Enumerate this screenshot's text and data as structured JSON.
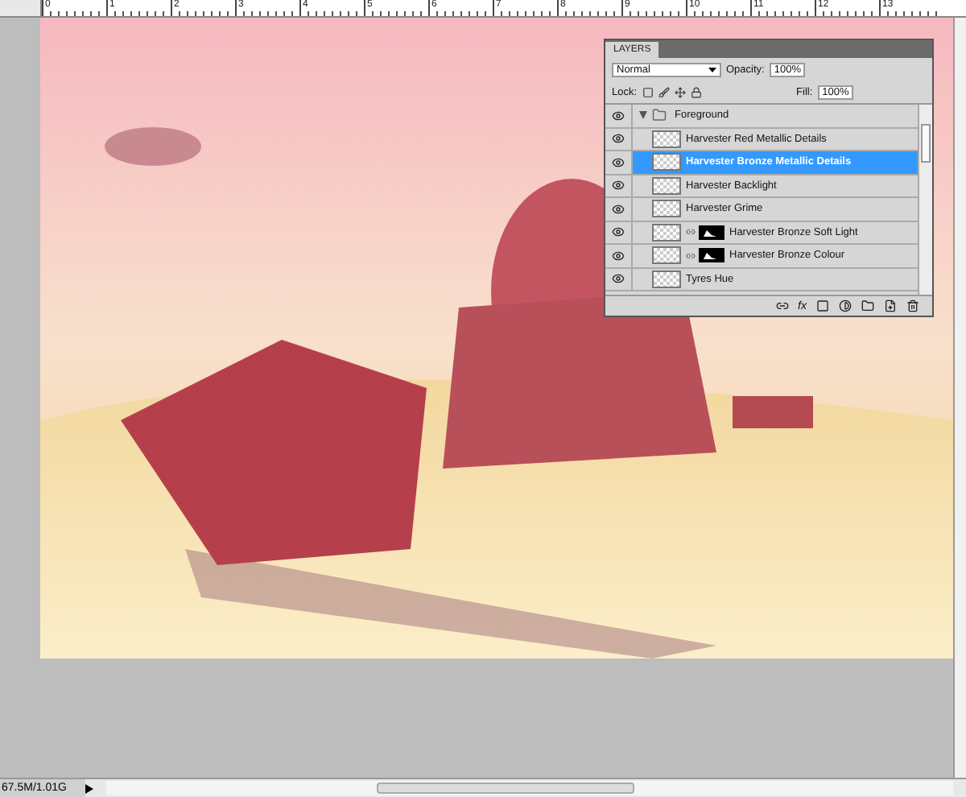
{
  "ruler": {
    "labels": [
      "0",
      "1",
      "2",
      "3",
      "4",
      "5",
      "6",
      "7",
      "8",
      "9",
      "10",
      "11",
      "12",
      "13"
    ]
  },
  "layers_panel": {
    "title": "LAYERS",
    "blend_mode": "Normal",
    "opacity_label": "Opacity:",
    "opacity": "100%",
    "lock_label": "Lock:",
    "fill_label": "Fill:",
    "fill": "100%",
    "layers": [
      {
        "name": "Foreground",
        "kind": "group",
        "expanded": true,
        "visible": true,
        "selected": false,
        "children": [
          {
            "name": "Harvester Red Metallic Details",
            "visible": true,
            "selected": false,
            "mask": false
          },
          {
            "name": "Harvester Bronze Metallic Details",
            "visible": true,
            "selected": true,
            "mask": false
          },
          {
            "name": "Harvester Backlight",
            "visible": true,
            "selected": false,
            "mask": false
          },
          {
            "name": "Harvester Grime",
            "visible": true,
            "selected": false,
            "mask": false
          },
          {
            "name": "Harvester Bronze Soft Light",
            "visible": true,
            "selected": false,
            "mask": true
          },
          {
            "name": "Harvester Bronze Colour",
            "visible": true,
            "selected": false,
            "mask": true
          },
          {
            "name": "Tyres Hue",
            "visible": true,
            "selected": false,
            "mask": false
          }
        ]
      }
    ],
    "footer_fx": "fx"
  },
  "status_bar": {
    "doc_size": "67.5M/1.01G"
  }
}
